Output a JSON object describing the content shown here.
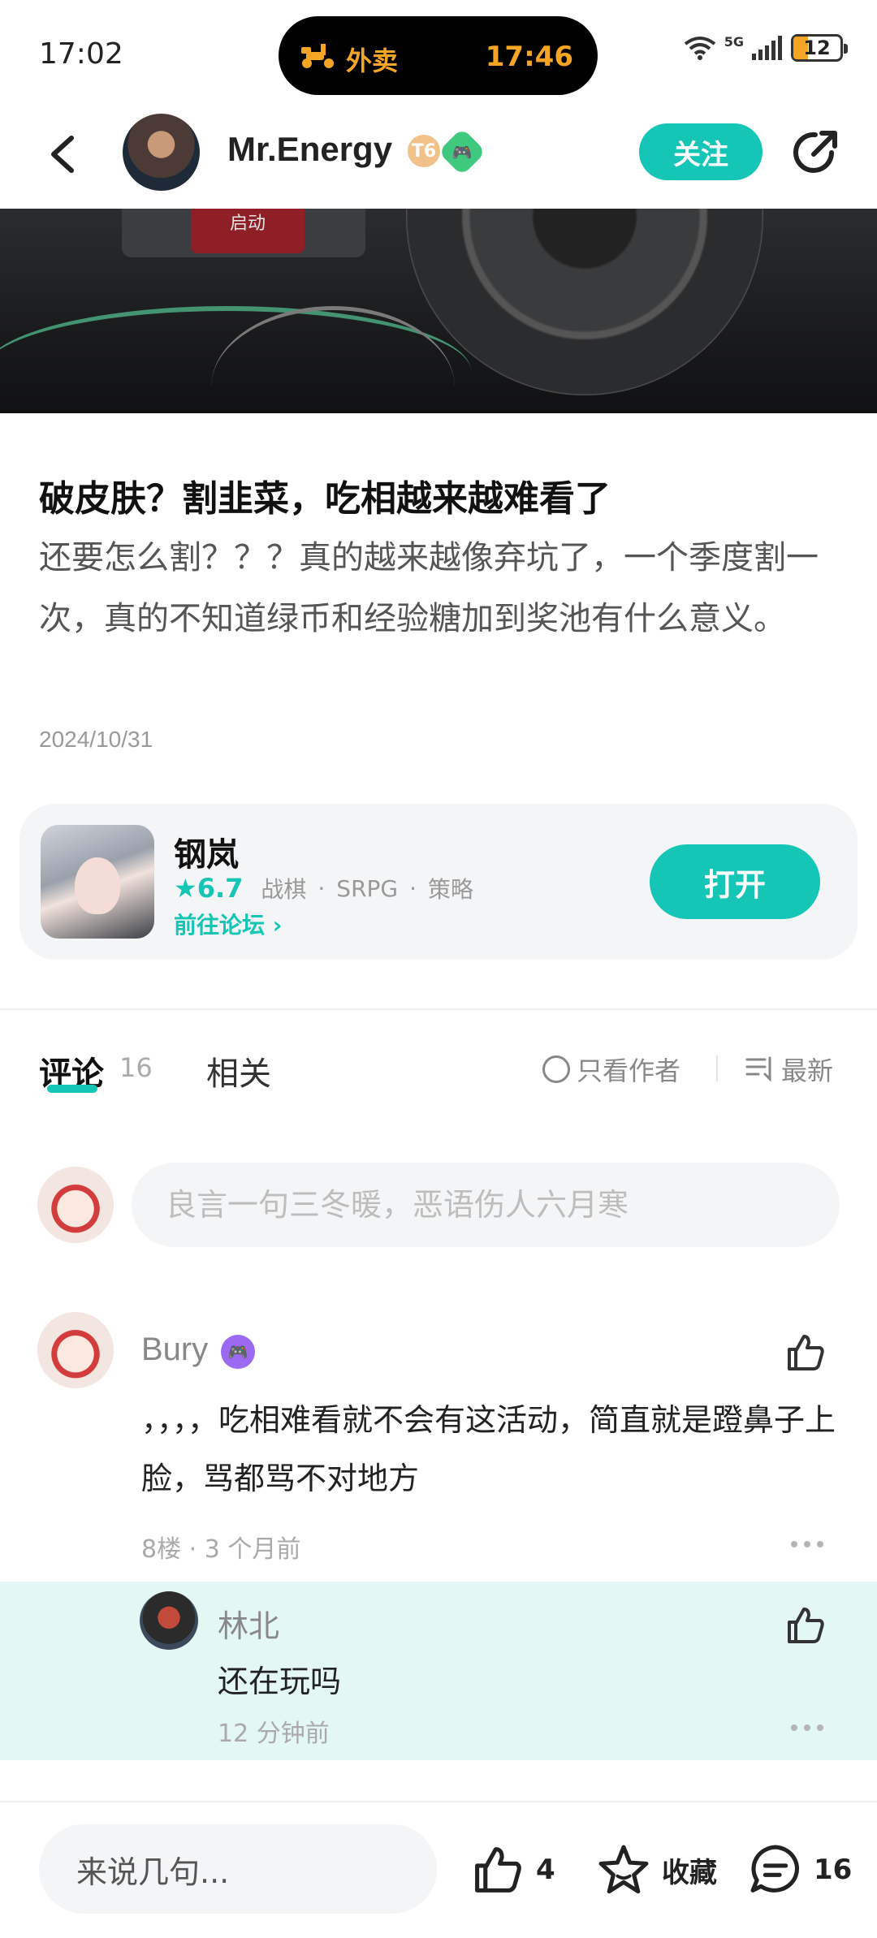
{
  "status_bar": {
    "time": "17:02",
    "island_label": "外卖",
    "island_time": "17:46",
    "network": "5G",
    "battery": "12"
  },
  "header": {
    "username": "Mr.Energy",
    "level_badge": "T6",
    "follow_label": "关注"
  },
  "post": {
    "title": "破皮肤？割韭菜，吃相越来越难看了",
    "body": "还要怎么割？？？真的越来越像弃坑了，一个季度割一次，真的不知道绿币和经验糖加到奖池有什么意义。",
    "date": "2024/10/31",
    "banner_text": "启动"
  },
  "game_card": {
    "name": "钢岚",
    "rating": "6.7",
    "tags": [
      "战棋",
      "SRPG",
      "策略"
    ],
    "forum_link": "前往论坛",
    "open_label": "打开"
  },
  "tabs": {
    "comments_label": "评论",
    "comments_count": "16",
    "related_label": "相关",
    "only_author_label": "只看作者",
    "sort_label": "最新"
  },
  "comment_input": {
    "placeholder": "良言一句三冬暖，恶语伤人六月寒"
  },
  "comments": [
    {
      "name": "Bury",
      "text": "，，，，吃相难看就不会有这活动，简直就是蹬鼻子上脸，骂都骂不对地方",
      "meta": "8楼 · 3 个月前",
      "reply": {
        "name": "林北",
        "text": "还在玩吗",
        "meta": "12 分钟前"
      }
    }
  ],
  "bottom_bar": {
    "say_placeholder": "来说几句...",
    "like_count": "4",
    "fav_label": "收藏",
    "comment_count": "16"
  },
  "colors": {
    "accent": "#15c5b5",
    "reply_bg": "#e3f7f5",
    "island_text": "#f5a524"
  }
}
